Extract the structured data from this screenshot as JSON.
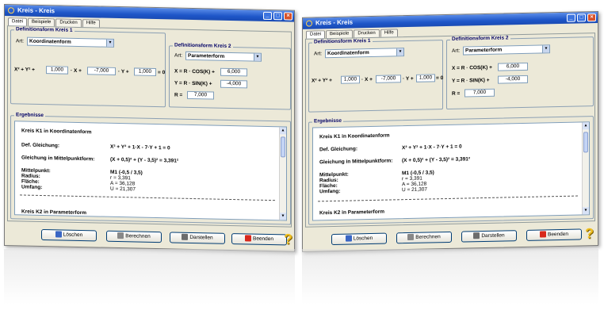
{
  "windows": [
    {
      "title": "Kreis - Kreis",
      "tabs": [
        "Datei",
        "Beispiele",
        "Drucken",
        "Hilfe"
      ],
      "def1": {
        "group_label": "Definitionsform Kreis 1",
        "art_label": "Art:",
        "art_value": "Koordinatenform",
        "eq_x2y2": "X² + Y² +",
        "eq_x": "· X +",
        "eq_y": "· Y +",
        "eq_end": "= 0",
        "val1": "1,000",
        "val2": "-7,000",
        "val3": "1,000"
      },
      "def2": {
        "group_label": "Definitionsform Kreis 2",
        "art_label": "Art:",
        "art_value": "Parameterform",
        "x_label": "X = R · COS(K) +",
        "y_label": "Y = R · SIN(K) +",
        "r_label": "R =",
        "x_val": "6,000",
        "y_val": "-4,000",
        "r_val": "7,000"
      },
      "results": {
        "group_label": "Ergebnisse",
        "heading": "Kreis K1 in Koordinatenform",
        "def_label": "Def. Gleichung:",
        "def_value": "X² + Y² + 1·X - 7·Y + 1 = 0",
        "mp_label": "Gleichung in Mittelpunktform:",
        "mp_value": "(X + 0,5)² + (Y - 3,5)² = 3,391²",
        "mittelpunkt_label": "Mittelpunkt:",
        "mittelpunkt_value": "M1 (-0,5 / 3,5)",
        "radius_label": "Radius:",
        "radius_value": "r = 3,391",
        "flaeche_label": "Fläche:",
        "flaeche_value": "A = 36,128",
        "umfang_label": "Umfang:",
        "umfang_value": "U = 21,307",
        "k2_heading": "Kreis K2 in Parameterform"
      },
      "buttons": {
        "clear": "Löschen",
        "calc": "Berechnen",
        "draw": "Darstellen",
        "quit": "Beenden"
      },
      "help_glyph": "?"
    },
    {
      "title": "Kreis - Kreis",
      "tabs": [
        "Datei",
        "Beispiele",
        "Drucken",
        "Hilfe"
      ],
      "def1": {
        "group_label": "Definitionsform Kreis 1",
        "art_label": "Art:",
        "art_value": "Koordinatenform",
        "eq_x2y2": "X² + Y² +",
        "eq_x": "· X +",
        "eq_y": "· Y +",
        "eq_end": "= 0",
        "val1": "1,000",
        "val2": "-7,000",
        "val3": "1,000"
      },
      "def2": {
        "group_label": "Definitionsform Kreis 2",
        "art_label": "Art:",
        "art_value": "Parameterform",
        "x_label": "X = R · COS(K) +",
        "y_label": "Y = R · SIN(K) +",
        "r_label": "R =",
        "x_val": "6,000",
        "y_val": "-4,000",
        "r_val": "7,000"
      },
      "results": {
        "group_label": "Ergebnisse",
        "heading": "Kreis K1 in Koordinatenform",
        "def_label": "Def. Gleichung:",
        "def_value": "X² + Y² + 1·X - 7·Y + 1 = 0",
        "mp_label": "Gleichung in Mittelpunktform:",
        "mp_value": "(X + 0,5)² + (Y - 3,5)² = 3,391²",
        "mittelpunkt_label": "Mittelpunkt:",
        "mittelpunkt_value": "M1 (-0,5 / 3,5)",
        "radius_label": "Radius:",
        "radius_value": "r = 3,391",
        "flaeche_label": "Fläche:",
        "flaeche_value": "A = 36,128",
        "umfang_label": "Umfang:",
        "umfang_value": "U = 21,307",
        "k2_heading": "Kreis K2 in Parameterform"
      },
      "buttons": {
        "clear": "Löschen",
        "calc": "Berechnen",
        "draw": "Darstellen",
        "quit": "Beenden"
      },
      "help_glyph": "?"
    }
  ]
}
